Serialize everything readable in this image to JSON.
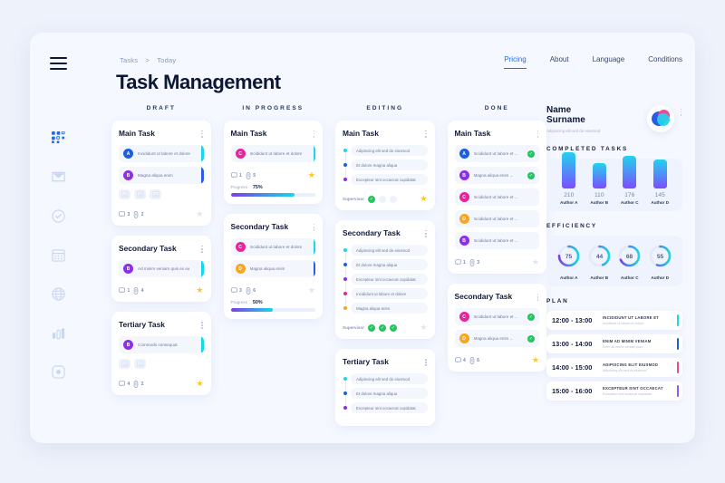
{
  "breadcrumb": {
    "root": "Tasks",
    "sep": ">",
    "current": "Today"
  },
  "page_title": "Task Management",
  "topnav": [
    {
      "label": "Pricing",
      "active": true
    },
    {
      "label": "About",
      "active": false
    },
    {
      "label": "Language",
      "active": false
    },
    {
      "label": "Conditions",
      "active": false
    }
  ],
  "sidebar": {
    "menu_icon": "hamburger-icon",
    "items": [
      {
        "icon": "dashboard-grid-icon",
        "active": true
      },
      {
        "icon": "mail-icon",
        "active": false
      },
      {
        "icon": "check-circle-icon",
        "active": false
      },
      {
        "icon": "calendar-icon",
        "active": false
      },
      {
        "icon": "globe-icon",
        "active": false
      },
      {
        "icon": "bar-chart-icon",
        "active": false
      },
      {
        "icon": "settings-icon",
        "active": false
      }
    ]
  },
  "colors": {
    "accent": "#1b6ef3",
    "star_on": "#fdc625",
    "check_green": "#22c55e",
    "gradient_start": "#7b3fe4",
    "gradient_end": "#18d7e8"
  },
  "board": {
    "columns": [
      {
        "title": "DRAFT",
        "cards": [
          {
            "title": "Main Task",
            "type": "avatar",
            "rows": [
              {
                "initial": "A",
                "color": "#1b5fe0",
                "text": "Incididunt ut labore et dolore",
                "edge": "#18d7e8",
                "check": false
              },
              {
                "initial": "B",
                "color": "#8b2fe8",
                "text": "Magna aliqua enim",
                "edge": "#2b5ce6",
                "check": false
              }
            ],
            "images": 3,
            "comments": "3",
            "attachments": "2",
            "starred": false
          },
          {
            "title": "Secondary Task",
            "type": "avatar",
            "rows": [
              {
                "initial": "B",
                "color": "#8b2fe8",
                "text": "Ad minim veniam  quis ex ea",
                "edge": "#18d7e8",
                "check": false
              }
            ],
            "images": 0,
            "comments": "1",
            "attachments": "4",
            "starred": true
          },
          {
            "title": "Tertiary Task",
            "type": "avatar",
            "rows": [
              {
                "initial": "B",
                "color": "#8b2fe8",
                "text": "Commodo consequat",
                "edge": "#18d7e8",
                "check": false
              }
            ],
            "images": 2,
            "comments": "4",
            "attachments": "2",
            "starred": true
          }
        ]
      },
      {
        "title": "IN PROGRESS",
        "cards": [
          {
            "title": "Main Task",
            "type": "avatar",
            "rows": [
              {
                "initial": "C",
                "color": "#e5269b",
                "text": "Incididunt ut labore et dolore",
                "edge": "#18d7e8",
                "check": false
              }
            ],
            "images": 0,
            "comments": "1",
            "attachments": "5",
            "starred": true,
            "progress_label": "Progress",
            "progress_value": "75%",
            "progress_pct": 75
          },
          {
            "title": "Secondary Task",
            "type": "avatar",
            "rows": [
              {
                "initial": "C",
                "color": "#e5269b",
                "text": "Incididunt ut labore et dolore",
                "edge": "#18d7e8",
                "check": false
              },
              {
                "initial": "D",
                "color": "#f5a623",
                "text": "Magna aliqua enim",
                "edge": "#2b5ce6",
                "check": false
              }
            ],
            "images": 0,
            "comments": "3",
            "attachments": "6",
            "starred": false,
            "progress_label": "Progress",
            "progress_value": "50%",
            "progress_pct": 50
          }
        ]
      },
      {
        "title": "EDITING",
        "cards": [
          {
            "title": "Main Task",
            "type": "bullets",
            "rows": [
              {
                "dot": "#18d7e8",
                "text": "Adipiscing elit sed do eiusmod"
              },
              {
                "dot": "#1b5fe0",
                "text": "Et dolore magna aliqua"
              },
              {
                "dot": "#8b2fe8",
                "text": "Excepteur sint occaecat cupidatat"
              }
            ],
            "supervisor_label": "Supervisor",
            "checks": [
              true,
              false,
              false
            ],
            "starred": true
          },
          {
            "title": "Secondary Task",
            "type": "bullets",
            "rows": [
              {
                "dot": "#18d7e8",
                "text": "Adipiscing elit sed do eiusmod"
              },
              {
                "dot": "#1b5fe0",
                "text": "Et dolore magna aliqua"
              },
              {
                "dot": "#8b2fe8",
                "text": "Excepteur sint occaecat cupidatat"
              },
              {
                "dot": "#e5269b",
                "text": "Incididunt ut labore et dolore"
              },
              {
                "dot": "#f5a623",
                "text": "Magna aliqua enim"
              }
            ],
            "supervisor_label": "Supervisor",
            "checks": [
              true,
              true,
              true
            ],
            "starred": false
          },
          {
            "title": "Tertiary Task",
            "type": "bullets",
            "rows": [
              {
                "dot": "#18d7e8",
                "text": "Adipiscing elit sed do eiusmod"
              },
              {
                "dot": "#1b5fe0",
                "text": "Et dolore magna aliqua"
              },
              {
                "dot": "#8b2fe8",
                "text": "Excepteur sint occaecat cupidatat"
              }
            ],
            "supervisor_label": "",
            "checks": [],
            "starred": false
          }
        ]
      },
      {
        "title": "DONE",
        "cards": [
          {
            "title": "Main Task",
            "type": "avatar",
            "rows": [
              {
                "initial": "A",
                "color": "#1b5fe0",
                "text": "Incididunt ut labore et ...",
                "edge": "",
                "check": true
              },
              {
                "initial": "B",
                "color": "#8b2fe8",
                "text": "Magna aliqua enim ...",
                "edge": "",
                "check": true
              },
              {
                "initial": "C",
                "color": "#e5269b",
                "text": "Incididunt ut labore et ...",
                "edge": "",
                "check": false
              },
              {
                "initial": "D",
                "color": "#f5a623",
                "text": "Incididunt ut labore et ...",
                "edge": "",
                "check": false
              },
              {
                "initial": "B",
                "color": "#8b2fe8",
                "text": "Incididunt ut labore et ...",
                "edge": "",
                "check": false
              }
            ],
            "images": 0,
            "comments": "1",
            "attachments": "3",
            "starred": false
          },
          {
            "title": "Secondary Task",
            "type": "avatar",
            "rows": [
              {
                "initial": "C",
                "color": "#e5269b",
                "text": "Incididunt ut labore et ...",
                "edge": "",
                "check": true
              },
              {
                "initial": "D",
                "color": "#f5a623",
                "text": "Magna aliqua enim ...",
                "edge": "",
                "check": true
              }
            ],
            "images": 0,
            "comments": "4",
            "attachments": "6",
            "starred": true
          }
        ]
      }
    ]
  },
  "profile": {
    "name_line1": "Name",
    "name_line2": "Surname",
    "subtitle": "Adipiscing elit sed do eiusmod",
    "avatar": "profile-circles-avatar",
    "menu": "more-options-icon"
  },
  "completed": {
    "title": "COMPLETED TASKS"
  },
  "efficiency": {
    "title": "EFFICIENCY"
  },
  "plan": {
    "title": "PLAN",
    "rows": [
      {
        "time": "12:00 - 13:00",
        "heading": "INCIDIDUNT UT LABORE ET",
        "sub": "Incididunt ut labore et dolore",
        "edge": "#18d7e8"
      },
      {
        "time": "13:00 - 14:00",
        "heading": "ENIM AD MINIM VENIAM",
        "sub": "Enim ad minim veniam quis",
        "edge": "#1b5fe0"
      },
      {
        "time": "14:00 - 15:00",
        "heading": "ADIPISCING ELIT EIUSMOD",
        "sub": "Adipiscing elit sed do eiusmod",
        "edge": "#ec4899"
      },
      {
        "time": "15:00 - 16:00",
        "heading": "EXCEPTEUR SINT OCCAECAT",
        "sub": "Excepteur sint occaecat cupidatat",
        "edge": "#8b5cf6"
      }
    ]
  },
  "chart_data": [
    {
      "type": "bar",
      "title": "COMPLETED TASKS",
      "categories": [
        "Author A",
        "Author B",
        "Author C",
        "Author D"
      ],
      "values": [
        210,
        110,
        176,
        145
      ],
      "xlabel": "",
      "ylabel": "",
      "ylim": [
        0,
        240
      ],
      "grid": false,
      "legend": "none"
    },
    {
      "type": "pie",
      "title": "EFFICIENCY",
      "categories": [
        "Author A",
        "Author B",
        "Author C",
        "Author D"
      ],
      "values": [
        75,
        44,
        68,
        55
      ],
      "unit": "%",
      "note": "four donut gauges, max 100",
      "legend": "none"
    }
  ]
}
